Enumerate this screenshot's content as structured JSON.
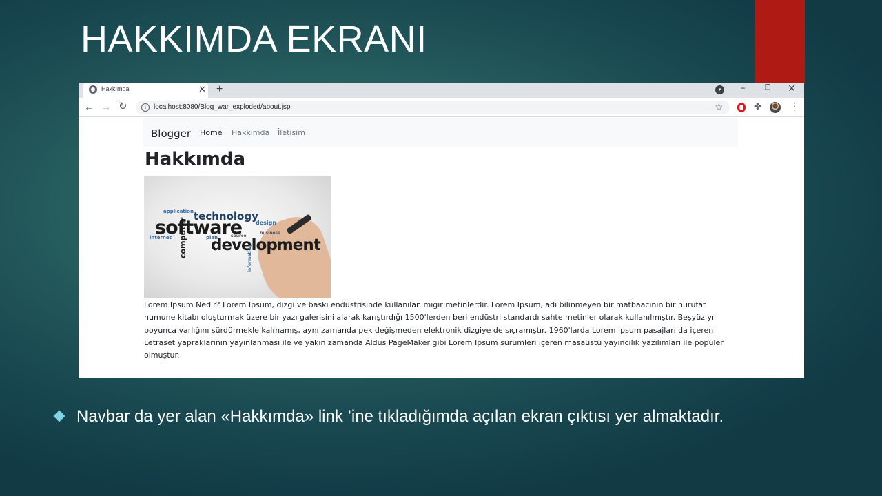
{
  "slide": {
    "title": "HAKKIMDA EKRANI",
    "bullet_text": "Navbar da yer alan «Hakkımda» link ’ine tıkladığımda açılan ekran çıktısı yer almaktadır.",
    "colors": {
      "background": "#2a6462",
      "accent_red": "#b01a14",
      "bullet": "#7fd3e6",
      "text": "#ffffff"
    }
  },
  "browser": {
    "tab": {
      "title": "Hakkımda",
      "favicon": "globe-icon",
      "close_glyph": "✕"
    },
    "new_tab_glyph": "+",
    "profile_glyph": "▾",
    "window_controls": {
      "minimize": "−",
      "maximize": "❐",
      "close": "✕"
    },
    "toolbar": {
      "back_glyph": "←",
      "forward_glyph": "→",
      "reload_glyph": "↻",
      "info_glyph": "i",
      "url": "localhost:8080/Blog_war_exploded/about.jsp",
      "star_glyph": "☆",
      "extensions_glyph": "✤",
      "menu_glyph": "⋮"
    }
  },
  "page": {
    "navbar": {
      "brand": "Blogger",
      "links": [
        "Home",
        "Hakkımda",
        "İletişim"
      ]
    },
    "heading": "Hakkımda",
    "image_words": {
      "w1": "technology",
      "w2": "software",
      "w3": "development",
      "w4": "computer",
      "w5": "application",
      "w6": "internet",
      "w7": "design",
      "w8": "plan",
      "w9": "source",
      "w10": "business",
      "w11": "information"
    },
    "paragraph": "Lorem Ipsum Nedir? Lorem Ipsum, dizgi ve baskı endüstrisinde kullanılan mıgır metinlerdir. Lorem Ipsum, adı bilinmeyen bir matbaacının bir hurufat numune kitabı oluşturmak üzere bir yazı galerisini alarak karıştırdığı 1500'lerden beri endüstri standardı sahte metinler olarak kullanılmıştır. Beşyüz yıl boyunca varlığını sürdürmekle kalmamış, aynı zamanda pek değişmeden elektronik dizgiye de sıçramıştır. 1960'larda Lorem Ipsum pasajları da içeren Letraset yapraklarının yayınlanması ile ve yakın zamanda Aldus PageMaker gibi Lorem Ipsum sürümleri içeren masaüstü yayıncılık yazılımları ile popüler olmuştur."
  }
}
